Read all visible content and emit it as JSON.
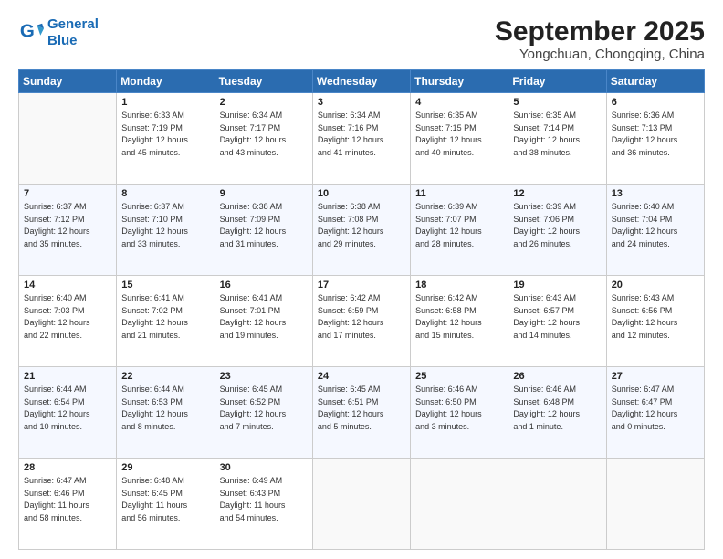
{
  "header": {
    "logo_line1": "General",
    "logo_line2": "Blue",
    "month": "September 2025",
    "location": "Yongchuan, Chongqing, China"
  },
  "weekdays": [
    "Sunday",
    "Monday",
    "Tuesday",
    "Wednesday",
    "Thursday",
    "Friday",
    "Saturday"
  ],
  "weeks": [
    [
      {
        "day": "",
        "info": ""
      },
      {
        "day": "1",
        "info": "Sunrise: 6:33 AM\nSunset: 7:19 PM\nDaylight: 12 hours\nand 45 minutes."
      },
      {
        "day": "2",
        "info": "Sunrise: 6:34 AM\nSunset: 7:17 PM\nDaylight: 12 hours\nand 43 minutes."
      },
      {
        "day": "3",
        "info": "Sunrise: 6:34 AM\nSunset: 7:16 PM\nDaylight: 12 hours\nand 41 minutes."
      },
      {
        "day": "4",
        "info": "Sunrise: 6:35 AM\nSunset: 7:15 PM\nDaylight: 12 hours\nand 40 minutes."
      },
      {
        "day": "5",
        "info": "Sunrise: 6:35 AM\nSunset: 7:14 PM\nDaylight: 12 hours\nand 38 minutes."
      },
      {
        "day": "6",
        "info": "Sunrise: 6:36 AM\nSunset: 7:13 PM\nDaylight: 12 hours\nand 36 minutes."
      }
    ],
    [
      {
        "day": "7",
        "info": "Sunrise: 6:37 AM\nSunset: 7:12 PM\nDaylight: 12 hours\nand 35 minutes."
      },
      {
        "day": "8",
        "info": "Sunrise: 6:37 AM\nSunset: 7:10 PM\nDaylight: 12 hours\nand 33 minutes."
      },
      {
        "day": "9",
        "info": "Sunrise: 6:38 AM\nSunset: 7:09 PM\nDaylight: 12 hours\nand 31 minutes."
      },
      {
        "day": "10",
        "info": "Sunrise: 6:38 AM\nSunset: 7:08 PM\nDaylight: 12 hours\nand 29 minutes."
      },
      {
        "day": "11",
        "info": "Sunrise: 6:39 AM\nSunset: 7:07 PM\nDaylight: 12 hours\nand 28 minutes."
      },
      {
        "day": "12",
        "info": "Sunrise: 6:39 AM\nSunset: 7:06 PM\nDaylight: 12 hours\nand 26 minutes."
      },
      {
        "day": "13",
        "info": "Sunrise: 6:40 AM\nSunset: 7:04 PM\nDaylight: 12 hours\nand 24 minutes."
      }
    ],
    [
      {
        "day": "14",
        "info": "Sunrise: 6:40 AM\nSunset: 7:03 PM\nDaylight: 12 hours\nand 22 minutes."
      },
      {
        "day": "15",
        "info": "Sunrise: 6:41 AM\nSunset: 7:02 PM\nDaylight: 12 hours\nand 21 minutes."
      },
      {
        "day": "16",
        "info": "Sunrise: 6:41 AM\nSunset: 7:01 PM\nDaylight: 12 hours\nand 19 minutes."
      },
      {
        "day": "17",
        "info": "Sunrise: 6:42 AM\nSunset: 6:59 PM\nDaylight: 12 hours\nand 17 minutes."
      },
      {
        "day": "18",
        "info": "Sunrise: 6:42 AM\nSunset: 6:58 PM\nDaylight: 12 hours\nand 15 minutes."
      },
      {
        "day": "19",
        "info": "Sunrise: 6:43 AM\nSunset: 6:57 PM\nDaylight: 12 hours\nand 14 minutes."
      },
      {
        "day": "20",
        "info": "Sunrise: 6:43 AM\nSunset: 6:56 PM\nDaylight: 12 hours\nand 12 minutes."
      }
    ],
    [
      {
        "day": "21",
        "info": "Sunrise: 6:44 AM\nSunset: 6:54 PM\nDaylight: 12 hours\nand 10 minutes."
      },
      {
        "day": "22",
        "info": "Sunrise: 6:44 AM\nSunset: 6:53 PM\nDaylight: 12 hours\nand 8 minutes."
      },
      {
        "day": "23",
        "info": "Sunrise: 6:45 AM\nSunset: 6:52 PM\nDaylight: 12 hours\nand 7 minutes."
      },
      {
        "day": "24",
        "info": "Sunrise: 6:45 AM\nSunset: 6:51 PM\nDaylight: 12 hours\nand 5 minutes."
      },
      {
        "day": "25",
        "info": "Sunrise: 6:46 AM\nSunset: 6:50 PM\nDaylight: 12 hours\nand 3 minutes."
      },
      {
        "day": "26",
        "info": "Sunrise: 6:46 AM\nSunset: 6:48 PM\nDaylight: 12 hours\nand 1 minute."
      },
      {
        "day": "27",
        "info": "Sunrise: 6:47 AM\nSunset: 6:47 PM\nDaylight: 12 hours\nand 0 minutes."
      }
    ],
    [
      {
        "day": "28",
        "info": "Sunrise: 6:47 AM\nSunset: 6:46 PM\nDaylight: 11 hours\nand 58 minutes."
      },
      {
        "day": "29",
        "info": "Sunrise: 6:48 AM\nSunset: 6:45 PM\nDaylight: 11 hours\nand 56 minutes."
      },
      {
        "day": "30",
        "info": "Sunrise: 6:49 AM\nSunset: 6:43 PM\nDaylight: 11 hours\nand 54 minutes."
      },
      {
        "day": "",
        "info": ""
      },
      {
        "day": "",
        "info": ""
      },
      {
        "day": "",
        "info": ""
      },
      {
        "day": "",
        "info": ""
      }
    ]
  ]
}
